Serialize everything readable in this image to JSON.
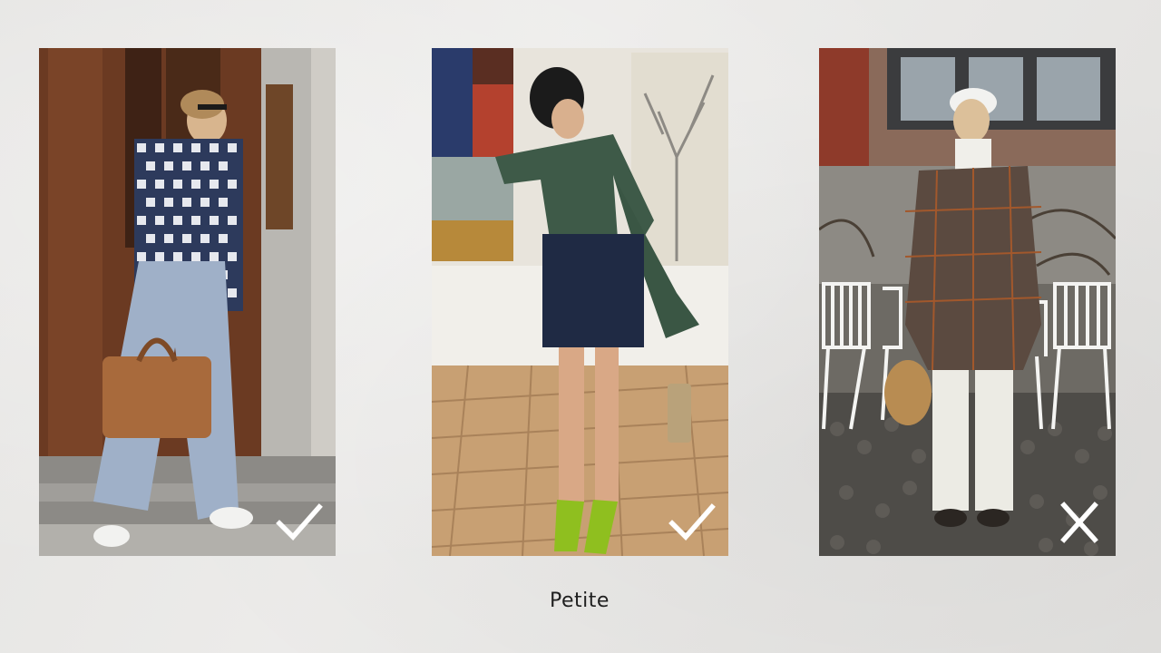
{
  "photos": [
    {
      "id": "outfit-gingham-jacket",
      "verdict": "check-icon"
    },
    {
      "id": "outfit-wrap-top-mini-skirt",
      "verdict": "check-icon"
    },
    {
      "id": "outfit-plaid-blazer",
      "verdict": "cross-icon"
    }
  ],
  "caption": "Petite",
  "colors": {
    "background": "#e9e8e6",
    "verdict_mark": "#ffffff",
    "caption_text": "#1f1f1f"
  }
}
